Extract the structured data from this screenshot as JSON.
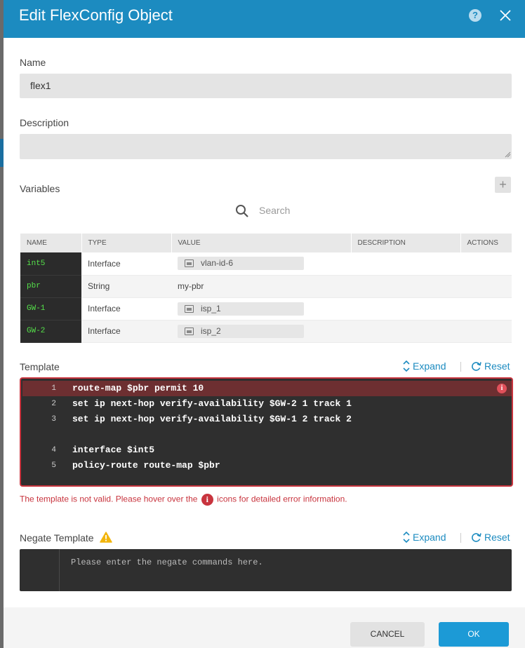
{
  "dialog": {
    "title": "Edit FlexConfig Object",
    "help_glyph": "?"
  },
  "name": {
    "label": "Name",
    "value": "flex1"
  },
  "description": {
    "label": "Description",
    "value": ""
  },
  "variables": {
    "label": "Variables",
    "add_glyph": "+",
    "search_placeholder": "Search",
    "columns": [
      "NAME",
      "TYPE",
      "VALUE",
      "DESCRIPTION",
      "ACTIONS"
    ],
    "rows": [
      {
        "name": "int5",
        "type": "Interface",
        "value": "vlan-id-6",
        "is_object": true
      },
      {
        "name": "pbr",
        "type": "String",
        "value": "my-pbr",
        "is_object": false
      },
      {
        "name": "GW-1",
        "type": "Interface",
        "value": "isp_1",
        "is_object": true
      },
      {
        "name": "GW-2",
        "type": "Interface",
        "value": "isp_2",
        "is_object": true
      }
    ]
  },
  "template": {
    "label": "Template",
    "expand_label": "Expand",
    "reset_label": "Reset",
    "lines": [
      {
        "num": "1",
        "text": "route-map $pbr permit 10",
        "error": true
      },
      {
        "num": "2",
        "text": "set ip next-hop verify-availability $GW-2 1 track 1",
        "error": false
      },
      {
        "num": "3",
        "text": "set ip next-hop verify-availability $GW-1 2 track 2",
        "error": false
      },
      {
        "num": "",
        "text": "",
        "error": false
      },
      {
        "num": "4",
        "text": "interface $int5",
        "error": false
      },
      {
        "num": "5",
        "text": "policy-route route-map $pbr",
        "error": false
      }
    ],
    "error_glyph": "i",
    "error_message_before": "The template is not valid. Please hover over the",
    "error_message_after": "icons for detailed error information."
  },
  "negate_template": {
    "label": "Negate Template",
    "expand_label": "Expand",
    "reset_label": "Reset",
    "placeholder": "Please enter the negate commands here."
  },
  "footer": {
    "cancel_label": "CANCEL",
    "ok_label": "OK"
  },
  "colors": {
    "header": "#1c8bc0",
    "error": "#c8343e",
    "variable_name": "#55e04a",
    "primary_button": "#1c9ad6"
  }
}
